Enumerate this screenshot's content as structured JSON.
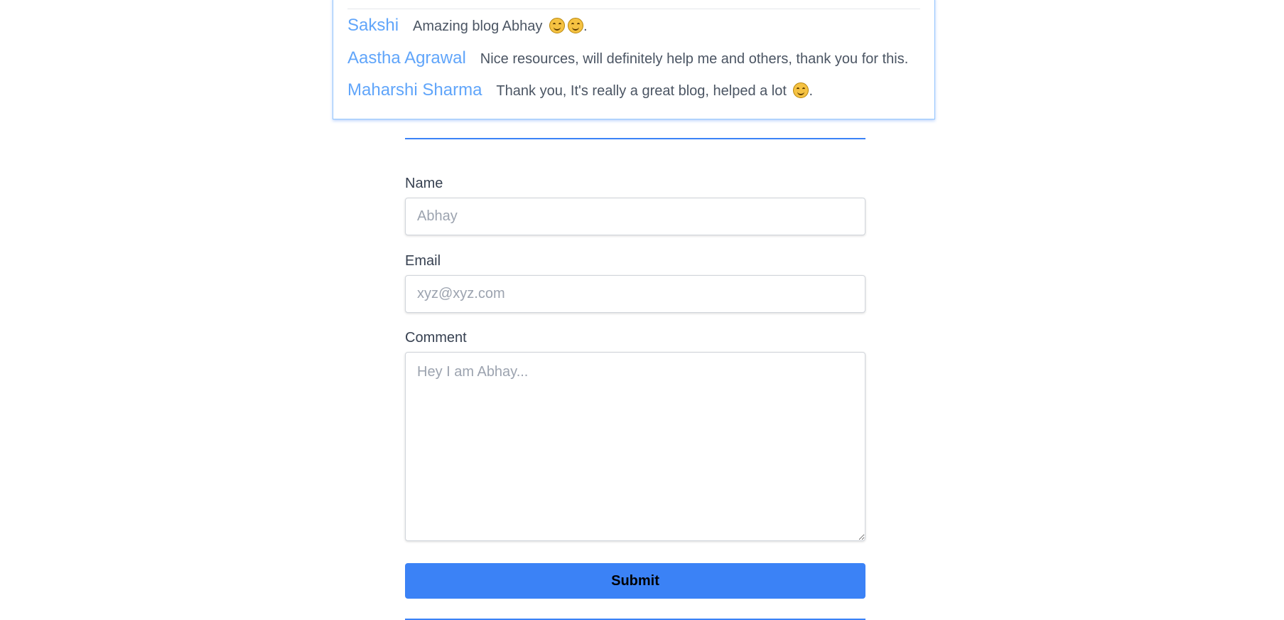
{
  "comments": [
    {
      "author": "Sakshi",
      "text": "Amazing blog Abhay ",
      "emojis": 2,
      "suffix": "."
    },
    {
      "author": "Aastha Agrawal",
      "text": "Nice resources, will definitely help me and others, thank you for this.",
      "emojis": 0,
      "suffix": ""
    },
    {
      "author": "Maharshi Sharma",
      "text": "Thank you, It's really a great blog, helped a lot ",
      "emojis": 1,
      "suffix": "."
    }
  ],
  "form": {
    "name_label": "Name",
    "name_placeholder": "Abhay",
    "email_label": "Email",
    "email_placeholder": "xyz@xyz.com",
    "comment_label": "Comment",
    "comment_placeholder": "Hey I am Abhay...",
    "submit_label": "Submit"
  },
  "colors": {
    "accent": "#3b82f6",
    "author": "#60a5fa",
    "emoji": "smiling-face-icon"
  }
}
